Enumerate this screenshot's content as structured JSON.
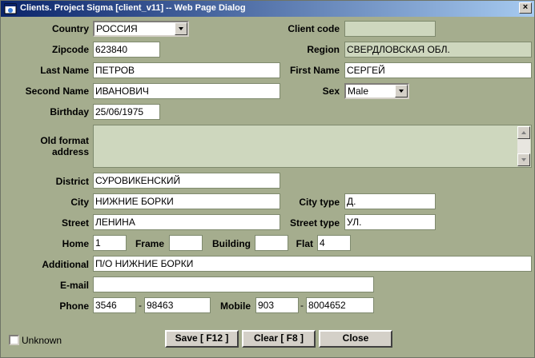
{
  "window": {
    "title": "Clients. Project Sigma [client_v11] -- Web Page Dialog"
  },
  "labels": {
    "country": "Country",
    "client_code": "Client code",
    "zipcode": "Zipcode",
    "region": "Region",
    "last_name": "Last Name",
    "first_name": "First Name",
    "second_name": "Second Name",
    "sex": "Sex",
    "birthday": "Birthday",
    "old_format_address": "Old format address",
    "district": "District",
    "city": "City",
    "city_type": "City type",
    "street": "Street",
    "street_type": "Street type",
    "home": "Home",
    "frame": "Frame",
    "building": "Building",
    "flat": "Flat",
    "additional": "Additional",
    "email": "E-mail",
    "phone": "Phone",
    "mobile": "Mobile",
    "unknown": "Unknown"
  },
  "values": {
    "country": "РОССИЯ",
    "client_code": "",
    "zipcode": "623840",
    "region": "СВЕРДЛОВСКАЯ ОБЛ.",
    "last_name": "ПЕТРОВ",
    "first_name": "СЕРГЕЙ",
    "second_name": "ИВАНОВИЧ",
    "sex": "Male",
    "birthday": "25/06/1975",
    "old_format_address": "",
    "district": "СУРОВИКЕНСКИЙ",
    "city": "НИЖНИЕ БОРКИ",
    "city_type": "Д.",
    "street": "ЛЕНИНА",
    "street_type": "УЛ.",
    "home": "1",
    "frame": "",
    "building": "",
    "flat": "4",
    "additional": "П/О НИЖНИЕ БОРКИ",
    "email": "",
    "phone_code": "3546",
    "phone_number": "98463",
    "mobile_code": "903",
    "mobile_number": "8004652",
    "unknown_checked": false
  },
  "separator": "-",
  "buttons": {
    "save": "Save [ F12 ]",
    "clear": "Clear [ F8 ]",
    "close": "Close"
  }
}
